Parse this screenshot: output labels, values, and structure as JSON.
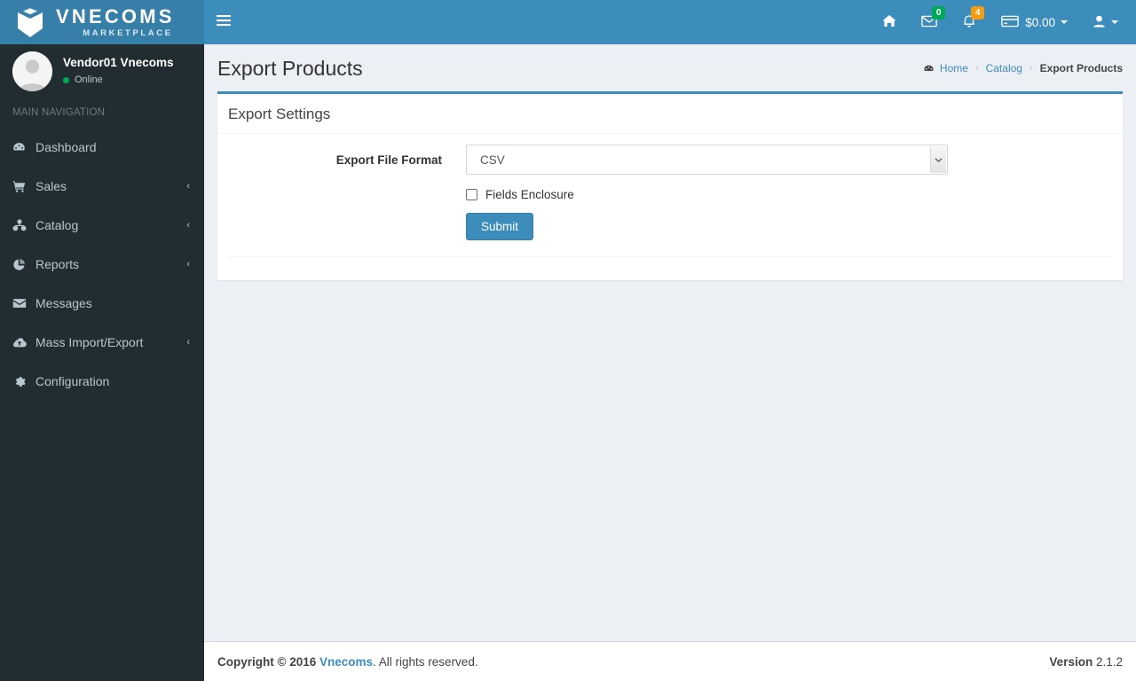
{
  "brand": {
    "logo_icon": "vnecoms-shield-icon",
    "title": "VNECOMS",
    "subtitle": "MARKETPLACE",
    "header_blue": "#3c8dbc",
    "logo_blue": "#367fa9",
    "sidebar_dark": "#222d32",
    "content_bg": "#ecf0f5"
  },
  "topbar": {
    "menu_toggle_icon": "hamburger-icon",
    "items": [
      {
        "icon": "home-icon",
        "label": "",
        "badge": null,
        "badge_color": null
      },
      {
        "icon": "envelope-icon",
        "label": "",
        "badge": "0",
        "badge_color": "#00a65a"
      },
      {
        "icon": "bell-icon",
        "label": "",
        "badge": "4",
        "badge_color": "#f39c12"
      },
      {
        "icon": "credit-card-icon",
        "label": "$0.00",
        "badge": null,
        "badge_color": null
      },
      {
        "icon": "user-icon",
        "label": "",
        "badge": null,
        "badge_color": null
      }
    ],
    "wallet_amount": "$0.00"
  },
  "sidebar": {
    "user": {
      "avatar_icon": "avatar-placeholder-icon",
      "name": "Vendor01 Vnecoms",
      "status": "Online",
      "status_color": "#00a65a"
    },
    "nav_header": "MAIN NAVIGATION",
    "items": [
      {
        "icon": "dashboard-icon",
        "label": "Dashboard",
        "expandable": false,
        "arrow": ""
      },
      {
        "icon": "shopping-cart-icon",
        "label": "Sales",
        "expandable": true,
        "arrow": "‹"
      },
      {
        "icon": "sitemap-icon",
        "label": "Catalog",
        "expandable": true,
        "arrow": "‹"
      },
      {
        "icon": "pie-chart-icon",
        "label": "Reports",
        "expandable": true,
        "arrow": "‹"
      },
      {
        "icon": "envelope-icon",
        "label": "Messages",
        "expandable": false,
        "arrow": ""
      },
      {
        "icon": "cloud-upload-icon",
        "label": "Mass Import/Export",
        "expandable": true,
        "arrow": "‹"
      },
      {
        "icon": "gear-icon",
        "label": "Configuration",
        "expandable": false,
        "arrow": ""
      }
    ]
  },
  "page": {
    "title": "Export Products",
    "breadcrumb": {
      "home_icon": "dashboard-icon",
      "home": "Home",
      "separator": "›",
      "catalog": "Catalog",
      "current": "Export Products"
    }
  },
  "box": {
    "title": "Export Settings",
    "accent_color": "#3c8dbc"
  },
  "form": {
    "file_format_label": "Export File Format",
    "file_format_value": "CSV",
    "file_format_options": [
      "CSV"
    ],
    "select_arrow_icon": "chevron-down-icon",
    "fields_enclosure_label": "Fields Enclosure",
    "fields_enclosure_checked": false,
    "submit_label": "Submit"
  },
  "footer": {
    "copyright_bold": "Copyright © 2016",
    "company_link": "Vnecoms",
    "copyright_rest": ". All rights reserved.",
    "version_label": "Version",
    "version_number": "2.1.2"
  }
}
